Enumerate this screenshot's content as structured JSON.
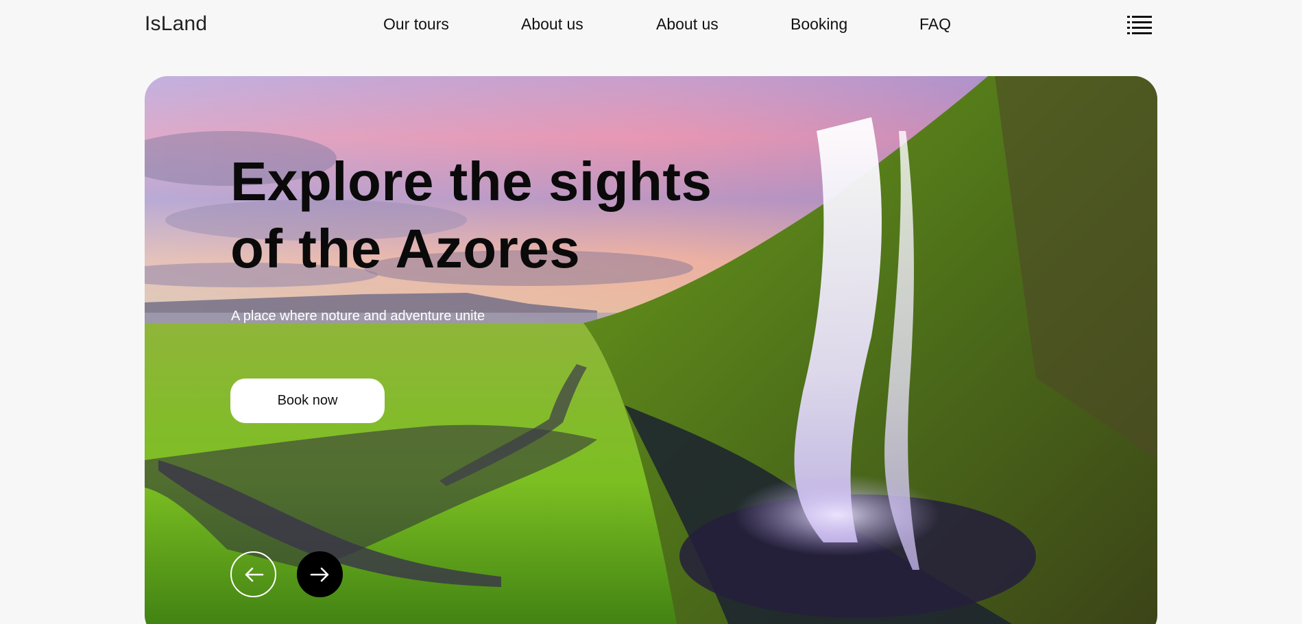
{
  "header": {
    "logo": "IsLand",
    "nav": [
      "Our tours",
      "About us",
      "About us",
      "Booking",
      "FAQ"
    ],
    "menu_icon": "hamburger-icon"
  },
  "hero": {
    "title_line1": "Explore the sights",
    "title_line2": "of the Azores",
    "subtitle": "A place where noture and adventure unite",
    "cta_label": "Book now",
    "prev_icon": "arrow-left-icon",
    "next_icon": "arrow-right-icon"
  }
}
